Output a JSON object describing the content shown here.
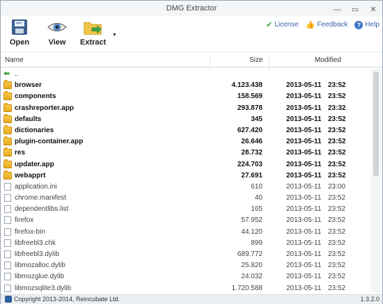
{
  "window": {
    "title": "DMG Extractor",
    "controls": [
      "—",
      "▭",
      "✕"
    ]
  },
  "toolbar": {
    "open_label": "Open",
    "view_label": "View",
    "extract_label": "Extract",
    "links": {
      "license": "License",
      "feedback": "Feedback",
      "help": "Help"
    }
  },
  "columns": {
    "name": "Name",
    "size": "Size",
    "modified": "Modified"
  },
  "rows": [
    {
      "type": "up",
      "name": "..",
      "size": "",
      "date": "",
      "time": ""
    },
    {
      "type": "dir",
      "name": "browser",
      "size": "4.123.438",
      "date": "2013-05-11",
      "time": "23:52"
    },
    {
      "type": "dir",
      "name": "components",
      "size": "158.569",
      "date": "2013-05-11",
      "time": "23:52"
    },
    {
      "type": "dir",
      "name": "crashreporter.app",
      "size": "293.878",
      "date": "2013-05-11",
      "time": "23:32"
    },
    {
      "type": "dir",
      "name": "defaults",
      "size": "345",
      "date": "2013-05-11",
      "time": "23:52"
    },
    {
      "type": "dir",
      "name": "dictionaries",
      "size": "627.420",
      "date": "2013-05-11",
      "time": "23:52"
    },
    {
      "type": "dir",
      "name": "plugin-container.app",
      "size": "26.646",
      "date": "2013-05-11",
      "time": "23:52"
    },
    {
      "type": "dir",
      "name": "res",
      "size": "28.732",
      "date": "2013-05-11",
      "time": "23:52"
    },
    {
      "type": "dir",
      "name": "updater.app",
      "size": "224.703",
      "date": "2013-05-11",
      "time": "23:52"
    },
    {
      "type": "dir",
      "name": "webapprt",
      "size": "27.691",
      "date": "2013-05-11",
      "time": "23:52"
    },
    {
      "type": "file",
      "name": "application.ini",
      "size": "610",
      "date": "2013-05-11",
      "time": "23:00"
    },
    {
      "type": "file",
      "name": "chrome.manifest",
      "size": "40",
      "date": "2013-05-11",
      "time": "23:52"
    },
    {
      "type": "file",
      "name": "dependentlibs.list",
      "size": "165",
      "date": "2013-05-11",
      "time": "23:52"
    },
    {
      "type": "file",
      "name": "firefox",
      "size": "57.952",
      "date": "2013-05-11",
      "time": "23:52"
    },
    {
      "type": "file",
      "name": "firefox-bin",
      "size": "44.120",
      "date": "2013-05-11",
      "time": "23:52"
    },
    {
      "type": "file",
      "name": "libfreebl3.chk",
      "size": "899",
      "date": "2013-05-11",
      "time": "23:52"
    },
    {
      "type": "file",
      "name": "libfreebl3.dylib",
      "size": "689.772",
      "date": "2013-05-11",
      "time": "23:52"
    },
    {
      "type": "file",
      "name": "libmozalloc.dylib",
      "size": "25.820",
      "date": "2013-05-11",
      "time": "23:52"
    },
    {
      "type": "file",
      "name": "libmozglue.dylib",
      "size": "24.032",
      "date": "2013-05-11",
      "time": "23:52"
    },
    {
      "type": "file",
      "name": "libmozsqlite3.dylib",
      "size": "1.720.588",
      "date": "2013-05-11",
      "time": "23:52"
    }
  ],
  "status": {
    "copyright": "Copyright 2013-2014, Reincubate Ltd.",
    "version": "1.3.2.0"
  },
  "icons": {
    "open": "disk-icon",
    "view": "eye-icon",
    "extract": "folder-extract-icon",
    "license": "check-icon",
    "feedback": "thumb-icon",
    "help": "help-icon"
  }
}
